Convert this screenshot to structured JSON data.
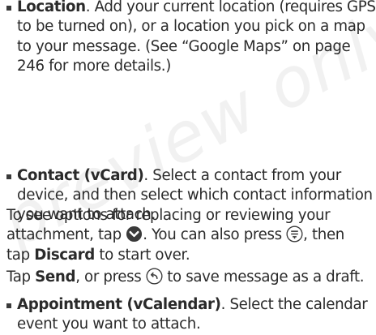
{
  "watermark": {
    "text": "preview only"
  },
  "bullets": [
    {
      "term": "Location",
      "text_lines": [
        ". Add your current location (requires GPS",
        "to be turned on), or a location you pick on a map",
        "to your message. (See “Google Maps” on page",
        "246 for more details.)"
      ]
    },
    {
      "term": "Contact (vCard)",
      "text_lines": [
        ". Select a contact from your",
        "device, and then select which contact information",
        "you want to attach."
      ]
    },
    {
      "term": "Appointment (vCalendar)",
      "text_lines": [
        ". Select the calendar",
        "event you want to attach."
      ]
    }
  ],
  "para1": {
    "line1": "To see options for replacing or reviewing your",
    "line2a": "attachment, tap ",
    "line2b": ". You can also press ",
    "line2c": ", then",
    "line3a": "tap ",
    "line3b": "Discard",
    "line3c": " to start over."
  },
  "para2": {
    "a": "Tap ",
    "b": "Send",
    "c": ", or press ",
    "d": " to save message as a draft."
  },
  "icons": {
    "attachment_options": "chevron-down-circle-icon",
    "menu": "menu-icon",
    "back": "back-icon"
  }
}
